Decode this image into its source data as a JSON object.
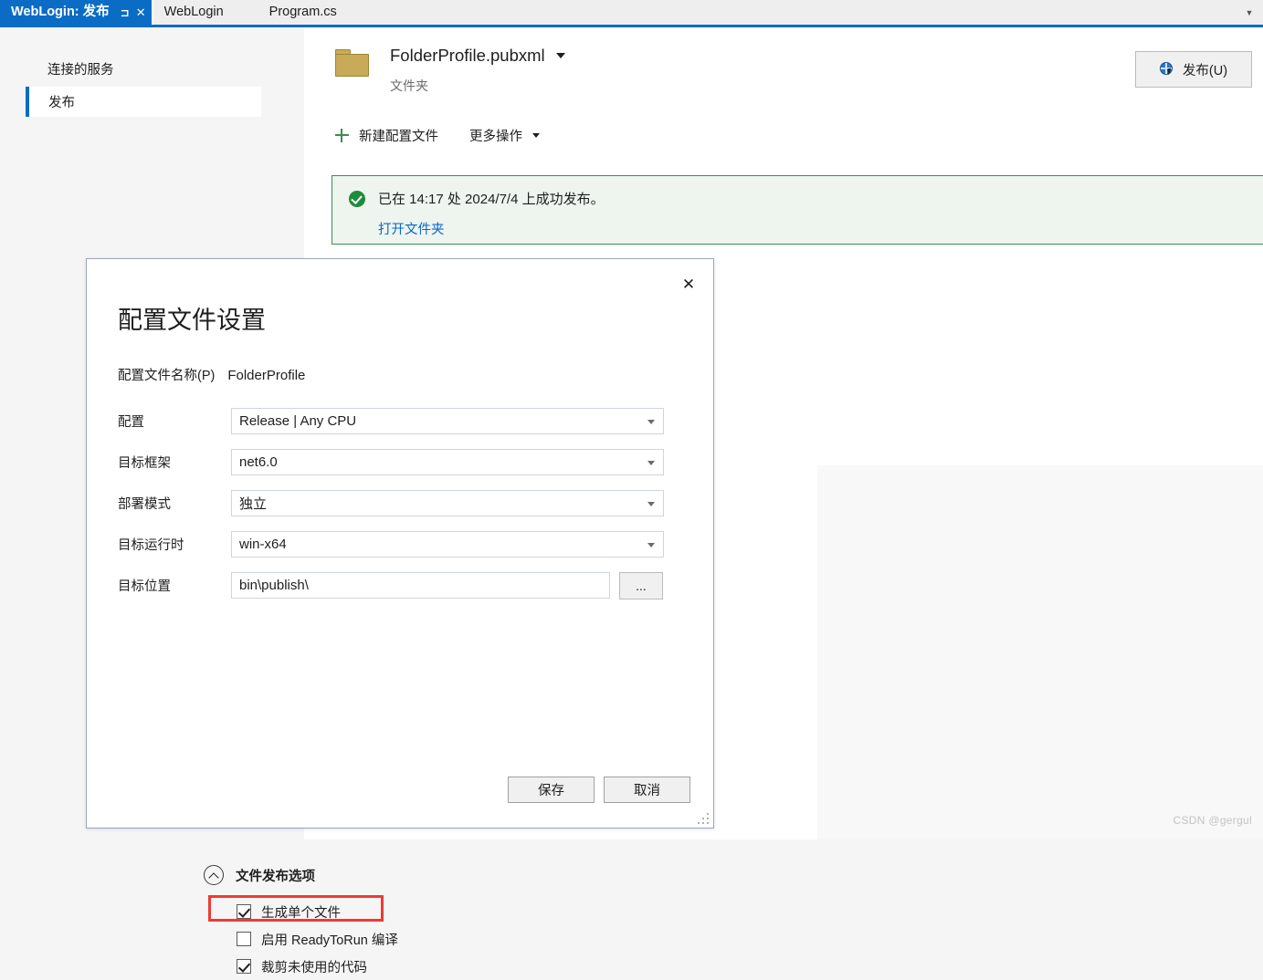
{
  "tabbar": {
    "tabs": [
      {
        "title": "WebLogin: 发布",
        "active": true,
        "pin_icon": "pin-icon",
        "close_icon": "close-icon"
      },
      {
        "title": "WebLogin",
        "active": false
      },
      {
        "title": "Program.cs",
        "active": false
      }
    ],
    "overflow_icon": "chevron-down-icon",
    "accent_color": "#0a6cc4"
  },
  "sidebar": {
    "header": "连接的服务",
    "items": [
      {
        "label": "发布",
        "selected": true
      }
    ]
  },
  "main": {
    "profile": {
      "icon": "folder-icon",
      "name": "FolderProfile.pubxml",
      "dropdown_icon": "chevron-down-icon",
      "subtitle": "文件夹"
    },
    "publish_button": {
      "label": "发布(U)",
      "icon": "publish-globe-icon"
    },
    "toolbar": {
      "new_profile_label": "新建配置文件",
      "new_profile_icon": "plus-icon",
      "more_actions_label": "更多操作",
      "more_actions_icon": "chevron-down-icon"
    },
    "status_banner": {
      "icon": "success-check-icon",
      "message": "已在 14:17 处 2024/7/4 上成功发布。",
      "link_label": "打开文件夹",
      "border_color": "#3a8f4f",
      "background_color": "#eef4ee"
    }
  },
  "dialog": {
    "close_icon": "close-icon",
    "title": "配置文件设置",
    "profile_name_label": "配置文件名称(P)",
    "profile_name_value": "FolderProfile",
    "fields": [
      {
        "label": "配置",
        "value": "Release | Any CPU",
        "type": "combo"
      },
      {
        "label": "目标框架",
        "value": "net6.0",
        "type": "combo"
      },
      {
        "label": "部署模式",
        "value": "独立",
        "type": "combo"
      },
      {
        "label": "目标运行时",
        "value": "win-x64",
        "type": "combo"
      }
    ],
    "target_location": {
      "label": "目标位置",
      "value": "bin\\publish\\",
      "browse_label": "..."
    },
    "section": {
      "title": "文件发布选项",
      "collapse_icon": "chevron-up-icon"
    },
    "checkboxes": [
      {
        "label": "生成单个文件",
        "checked": true,
        "highlighted": true
      },
      {
        "label": "启用 ReadyToRun 编译",
        "checked": false,
        "highlighted": false
      },
      {
        "label": "裁剪未使用的代码",
        "checked": true,
        "highlighted": false
      }
    ],
    "highlight_color": "#ee3b33",
    "buttons": {
      "save_label": "保存",
      "cancel_label": "取消"
    },
    "resize_grip_icon": "resize-grip-icon"
  },
  "watermark": "CSDN @gergul"
}
